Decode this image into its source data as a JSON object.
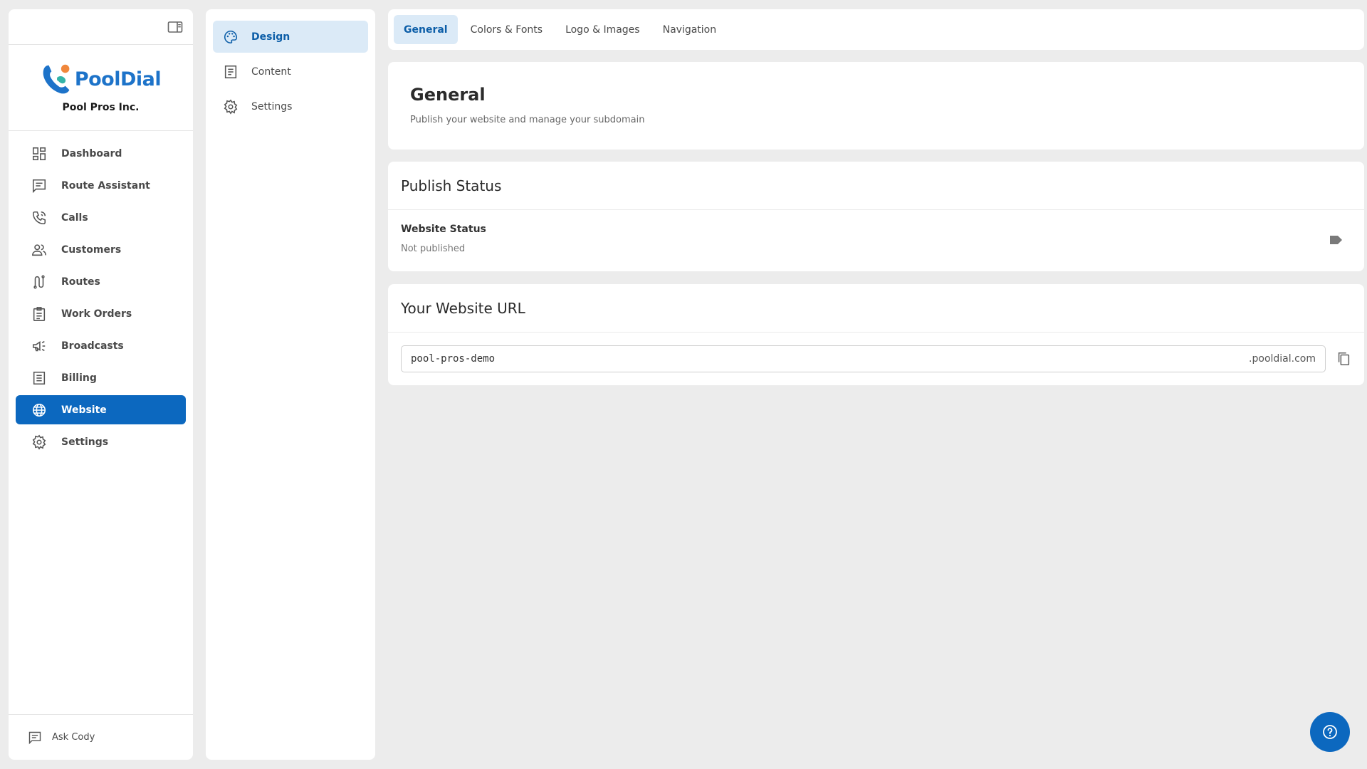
{
  "brand": {
    "logo_text": "PoolDial",
    "company_name": "Pool Pros Inc.",
    "colors": {
      "primary": "#0c68bf",
      "logo_blue": "#1d73c9",
      "logo_orange": "#f0873c",
      "logo_teal": "#34b4a8"
    }
  },
  "sidebar": {
    "items": [
      {
        "label": "Dashboard",
        "icon": "dashboard-icon"
      },
      {
        "label": "Route Assistant",
        "icon": "chat-icon"
      },
      {
        "label": "Calls",
        "icon": "phone-icon"
      },
      {
        "label": "Customers",
        "icon": "people-icon"
      },
      {
        "label": "Routes",
        "icon": "route-icon"
      },
      {
        "label": "Work Orders",
        "icon": "clipboard-icon"
      },
      {
        "label": "Broadcasts",
        "icon": "megaphone-icon"
      },
      {
        "label": "Billing",
        "icon": "receipt-icon"
      },
      {
        "label": "Website",
        "icon": "globe-icon",
        "active": true
      },
      {
        "label": "Settings",
        "icon": "gear-icon"
      }
    ],
    "footer_label": "Ask Cody"
  },
  "submenu": {
    "items": [
      {
        "label": "Design",
        "icon": "palette-icon",
        "active": true
      },
      {
        "label": "Content",
        "icon": "document-icon"
      },
      {
        "label": "Settings",
        "icon": "gear-icon"
      }
    ]
  },
  "tabs": [
    {
      "label": "General",
      "active": true
    },
    {
      "label": "Colors & Fonts"
    },
    {
      "label": "Logo & Images"
    },
    {
      "label": "Navigation"
    }
  ],
  "header": {
    "title": "General",
    "subtitle": "Publish your website and manage your subdomain"
  },
  "publish": {
    "title": "Publish Status",
    "label": "Website Status",
    "value": "Not published",
    "enabled": false
  },
  "url": {
    "title": "Your Website URL",
    "subdomain": "pool-pros-demo",
    "suffix": ".pooldial.com"
  }
}
